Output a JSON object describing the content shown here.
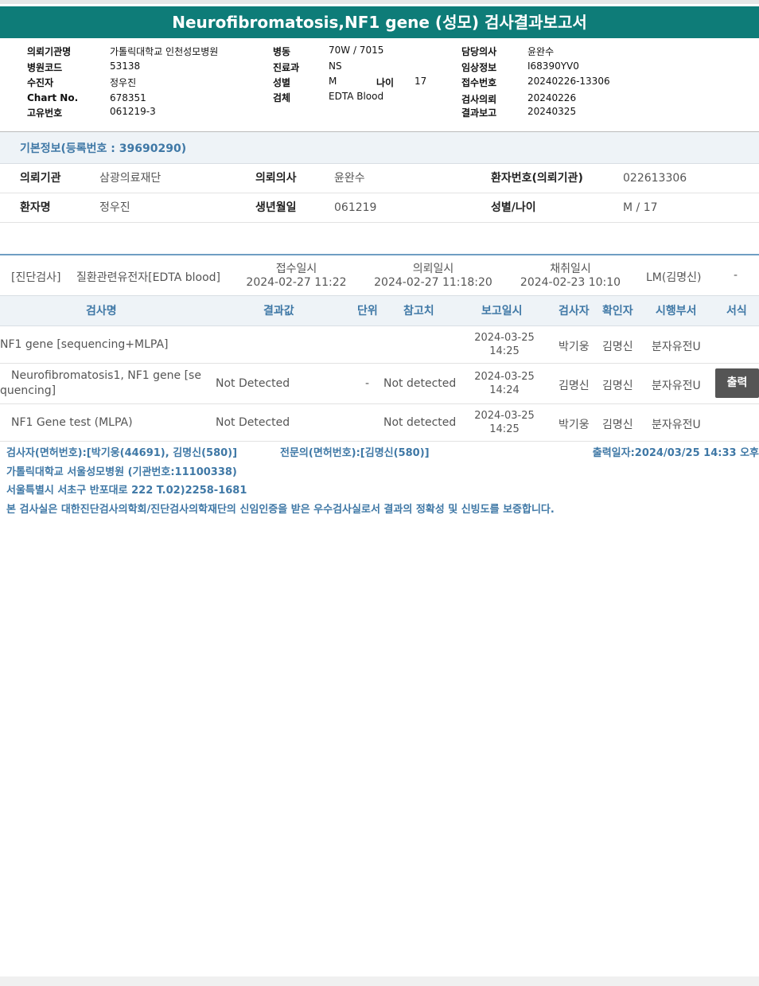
{
  "report": {
    "title": "Neurofibromatosis,NF1 gene (성모) 검사결과보고서"
  },
  "header": {
    "col1": [
      {
        "label": "의뢰기관명",
        "value": "가톨릭대학교 인천성모병원"
      },
      {
        "label": "병원코드",
        "value": "53138"
      },
      {
        "label": "수진자",
        "value": "정우진"
      },
      {
        "label": "Chart No.",
        "value": "678351"
      },
      {
        "label": "고유번호",
        "value": "061219-3"
      }
    ],
    "col2": [
      {
        "label": "병동",
        "value": "70W / 7015"
      },
      {
        "label": "진료과",
        "value": "NS"
      },
      {
        "label": "성별",
        "value": "M"
      },
      {
        "label": "검체",
        "value": "EDTA Blood"
      }
    ],
    "age": {
      "label": "나이",
      "value": "17"
    },
    "col3": [
      {
        "label": "담당의사",
        "value": "윤완수"
      },
      {
        "label": "임상정보",
        "value": "I68390YV0"
      },
      {
        "label": "접수번호",
        "value": "20240226-13306"
      },
      {
        "label": "검사의뢰",
        "value": "20240226"
      },
      {
        "label": "결과보고",
        "value": "20240325"
      }
    ]
  },
  "basic_info": {
    "title": "기본정보(등록번호 : 39690290)",
    "rows": [
      [
        {
          "label": "의뢰기관",
          "value": "삼광의료재단"
        },
        {
          "label": "의뢰의사",
          "value": "윤완수"
        },
        {
          "label": "환자번호(의뢰기관)",
          "value": "022613306"
        }
      ],
      [
        {
          "label": "환자명",
          "value": "정우진"
        },
        {
          "label": "생년월일",
          "value": "061219"
        },
        {
          "label": "성별/나이",
          "value": "M / 17"
        }
      ]
    ]
  },
  "order": {
    "category": "[진단검사]",
    "test_group": "질환관련유전자[EDTA blood]",
    "received_label": "접수일시",
    "received_value": "2024-02-27 11:22",
    "requested_label": "의뢰일시",
    "requested_value": "2024-02-27 11:18:20",
    "collected_label": "채취일시",
    "collected_value": "2024-02-23 10:10",
    "approver": "LM(김명신)",
    "extra": "-"
  },
  "table": {
    "headers": [
      "검사명",
      "결과값",
      "단위",
      "참고치",
      "보고일시",
      "검사자",
      "확인자",
      "시행부서",
      "서식"
    ],
    "rows": [
      {
        "name_line1": "NF1 gene [sequencing+MLPA]",
        "name_line2": "",
        "result": "",
        "unit": "",
        "reference": "",
        "date": "2024-03-25",
        "time": "14:25",
        "tester": "박기웅",
        "confirmer": "김명신",
        "dept": "분자유전U",
        "print": ""
      },
      {
        "name_line1": "Neurofibromatosis1, NF1 gene [se",
        "name_line2": "quencing]",
        "result": "Not Detected",
        "unit": "-",
        "reference": "Not detected",
        "date": "2024-03-25",
        "time": "14:24",
        "tester": "김명신",
        "confirmer": "김명신",
        "dept": "분자유전U",
        "print": "출력"
      },
      {
        "name_line1": "NF1 Gene test (MLPA)",
        "name_line2": "",
        "result": "Not Detected",
        "unit": "",
        "reference": "Not detected",
        "date": "2024-03-25",
        "time": "14:25",
        "tester": "박기웅",
        "confirmer": "김명신",
        "dept": "분자유전U",
        "print": ""
      }
    ]
  },
  "footer": {
    "testers": "검사자(면허번호):[박기웅(44691), 김명신(580)]",
    "specialist": "전문의(면허번호):[김명신(580)]",
    "printed": "출력일자:2024/03/25 14:33 오후",
    "hospital": "가톨릭대학교 서울성모병원 (기관번호:11100338)",
    "address": "서울특별시 서초구 반포대로 222 T.02)2258-1681",
    "certification": "본 검사실은 대한진단검사의학회/진단검사의학재단의 신임인증을 받은 우수검사실로서 결과의 정확성 및 신빙도를 보증합니다."
  },
  "colors": {
    "title_bar": "#0e7c78",
    "accent_text": "#3f78a6",
    "header_bg": "#eef3f7",
    "print_button": "#555555"
  }
}
